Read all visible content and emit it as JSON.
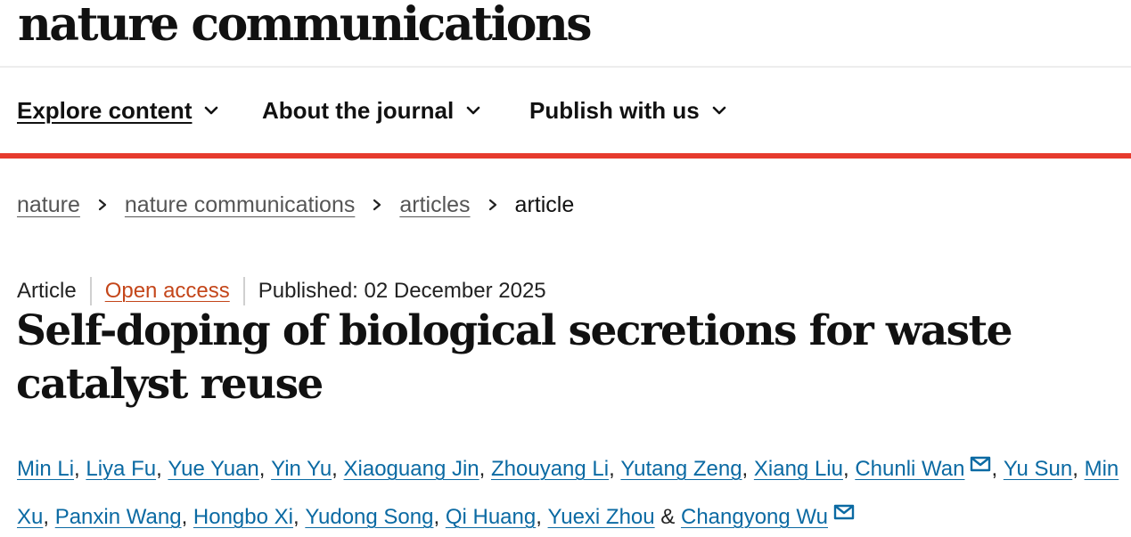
{
  "header": {
    "logo_text": "nature communications"
  },
  "nav": {
    "items": [
      {
        "label": "Explore content",
        "icon": "chevron-down-icon",
        "active": true
      },
      {
        "label": "About the journal",
        "icon": "chevron-down-icon",
        "active": false
      },
      {
        "label": "Publish with us",
        "icon": "chevron-down-icon",
        "active": false
      }
    ],
    "accent_color": "#e63b2e"
  },
  "breadcrumb": {
    "items": [
      "nature",
      "nature communications",
      "articles",
      "article"
    ],
    "separator_icon": "chevron-right-icon"
  },
  "article": {
    "type": "Article",
    "access": "Open access",
    "published": "Published: 02 December 2025",
    "title": "Self-doping of biological secretions for waste catalyst reuse",
    "access_color": "#c4461a",
    "link_color": "#0b6aa3"
  },
  "authors": {
    "list": [
      {
        "name": "Min Li",
        "after": ", "
      },
      {
        "name": "Liya Fu",
        "after": ", "
      },
      {
        "name": "Yue Yuan",
        "after": ", "
      },
      {
        "name": "Yin Yu",
        "after": ", "
      },
      {
        "name": "Xiaoguang Jin",
        "after": ", "
      },
      {
        "name": "Zhouyang Li",
        "after": ", "
      },
      {
        "name": "Yutang Zeng",
        "after": ", "
      },
      {
        "name": "Xiang Liu",
        "after": ", "
      },
      {
        "name": "Chunli Wan",
        "after": ", ",
        "icon": "mail-icon"
      },
      {
        "name": "Yu Sun",
        "after": ", "
      },
      {
        "name": "Min Xu",
        "after": ", "
      },
      {
        "name": "Panxin Wang",
        "after": ", "
      },
      {
        "name": "Hongbo Xi",
        "after": ", "
      },
      {
        "name": "Yudong Song",
        "after": ", "
      },
      {
        "name": "Qi Huang",
        "after": ", "
      },
      {
        "name": "Yuexi Zhou",
        "after": " & "
      },
      {
        "name": "Changyong Wu",
        "after": "",
        "icon": "mail-icon"
      }
    ]
  }
}
